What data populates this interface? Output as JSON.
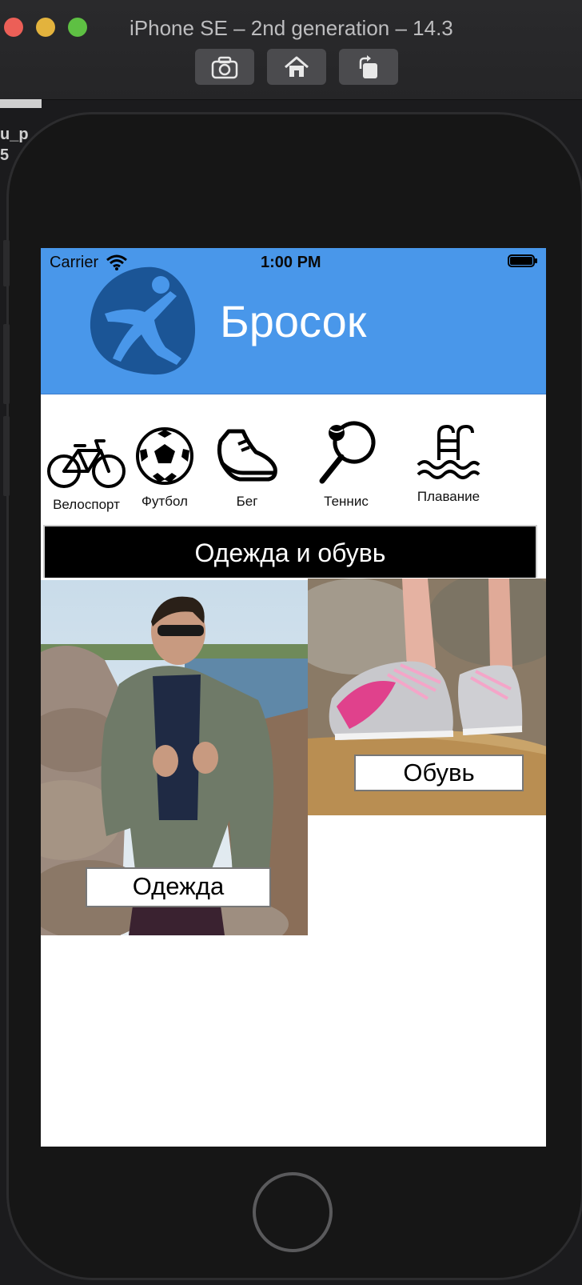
{
  "window": {
    "title": "iPhone SE – 2nd generation – 14.3",
    "toolbar": [
      "camera-icon",
      "home-icon",
      "rotate-icon"
    ],
    "left_fragment": "u_p\n5"
  },
  "status_bar": {
    "carrier": "Carrier",
    "time": "1:00 PM"
  },
  "header": {
    "brand": "Бросок",
    "background_color": "#4997ea"
  },
  "sports": [
    {
      "label": "Велоспорт",
      "icon": "bicycle-icon"
    },
    {
      "label": "Футбол",
      "icon": "soccer-ball-icon"
    },
    {
      "label": "Бег",
      "icon": "running-shoe-icon"
    },
    {
      "label": "Теннис",
      "icon": "tennis-racket-icon"
    },
    {
      "label": "Плавание",
      "icon": "swimming-pool-icon"
    }
  ],
  "section": {
    "title": "Одежда и обувь"
  },
  "categories": [
    {
      "label": "Одежда"
    },
    {
      "label": "Обувь"
    }
  ]
}
